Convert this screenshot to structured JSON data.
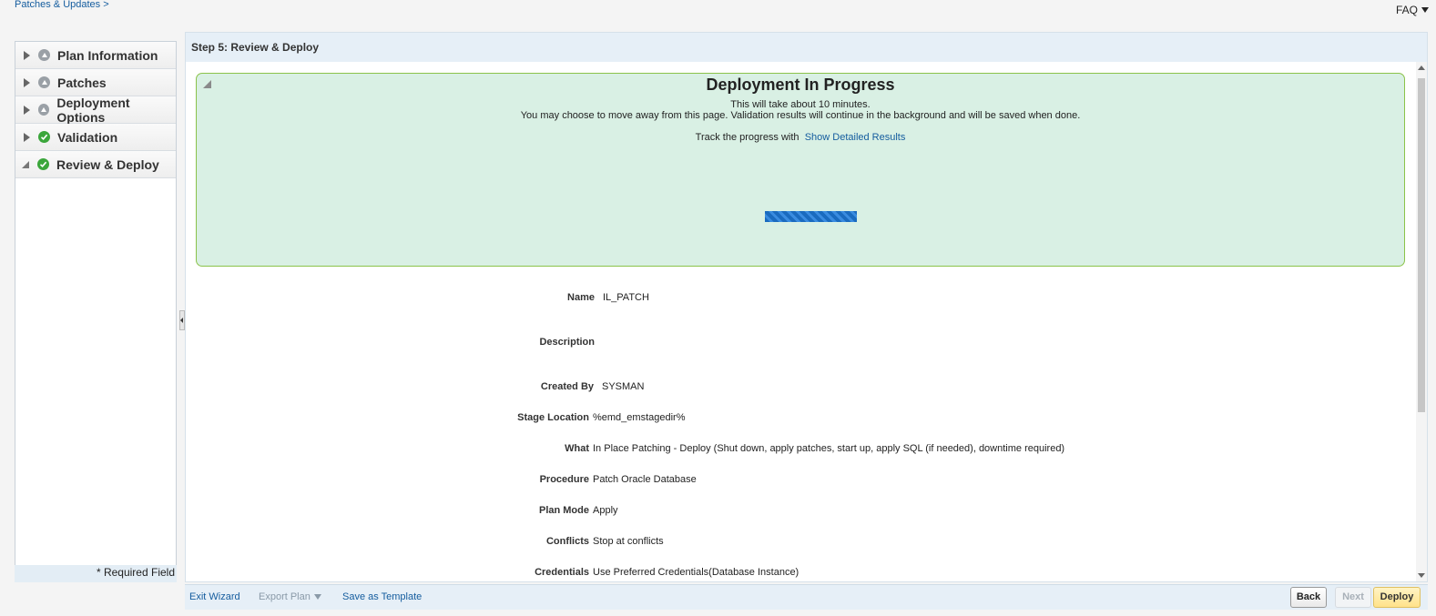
{
  "breadcrumb": "Patches & Updates >",
  "faq": "FAQ",
  "nav": {
    "items": [
      {
        "label": "Plan Information",
        "status": "pending"
      },
      {
        "label": "Patches",
        "status": "pending"
      },
      {
        "label": "Deployment Options",
        "status": "pending"
      },
      {
        "label": "Validation",
        "status": "done"
      },
      {
        "label": "Review & Deploy",
        "status": "done"
      }
    ],
    "required_field": "* Required Field"
  },
  "step_title": "Step 5: Review & Deploy",
  "progress": {
    "title": "Deployment In Progress",
    "line1": "This will take about 10 minutes.",
    "line2": "You may choose to move away from this page. Validation results will continue in the background and will be saved when done.",
    "track_text": "Track the progress with",
    "track_link": "Show Detailed Results"
  },
  "properties": {
    "name": {
      "label": "Name",
      "value": "IL_PATCH"
    },
    "description": {
      "label": "Description",
      "value": ""
    },
    "created_by": {
      "label": "Created By",
      "value": "SYSMAN"
    },
    "stage_location": {
      "label": "Stage Location",
      "value": "%emd_emstagedir%"
    },
    "what": {
      "label": "What",
      "value": "In Place Patching - Deploy (Shut down, apply patches, start up, apply SQL (if needed), downtime required)"
    },
    "procedure": {
      "label": "Procedure",
      "value": "Patch Oracle Database"
    },
    "plan_mode": {
      "label": "Plan Mode",
      "value": "Apply"
    },
    "conflicts": {
      "label": "Conflicts",
      "value": "Stop at conflicts"
    },
    "credentials": {
      "label": "Credentials",
      "value": "Use Preferred Credentials(Database Instance)"
    }
  },
  "footer": {
    "exit_wizard": "Exit Wizard",
    "export_plan": "Export Plan",
    "save_template": "Save as Template",
    "back": "Back",
    "next": "Next",
    "deploy": "Deploy"
  }
}
